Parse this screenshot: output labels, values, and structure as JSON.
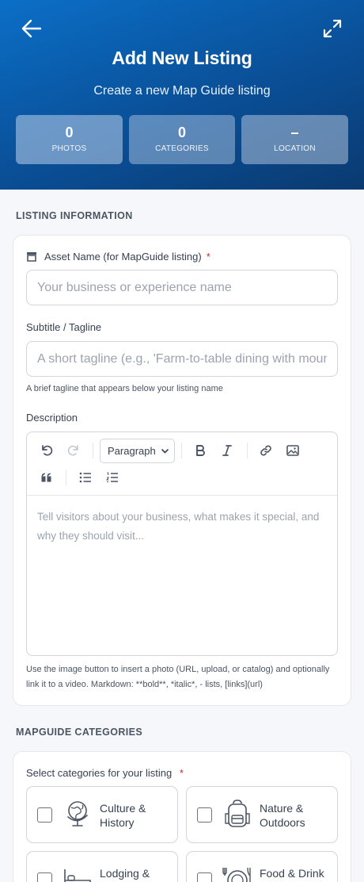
{
  "header": {
    "title": "Add New Listing",
    "subtitle": "Create a new Map Guide listing",
    "stats": [
      {
        "value": "0",
        "label": "PHOTOS"
      },
      {
        "value": "0",
        "label": "CATEGORIES"
      },
      {
        "value": "–",
        "label": "LOCATION"
      }
    ]
  },
  "listing": {
    "heading": "LISTING INFORMATION",
    "asset_label": "Asset Name (for MapGuide listing)",
    "asset_required": "*",
    "asset_placeholder": "Your business or experience name",
    "subtitle_label": "Subtitle / Tagline",
    "subtitle_placeholder": "A short tagline (e.g., 'Farm-to-table dining with mountain views')",
    "subtitle_help": "A brief tagline that appears below your listing name",
    "description_label": "Description",
    "editor": {
      "format_select": "Paragraph",
      "placeholder": "Tell visitors about your business, what makes it special, and why they should visit..."
    },
    "description_help": "Use the image button to insert a photo (URL, upload, or catalog) and optionally link it to a video. Markdown: **bold**, *italic*, - lists, [links](url)"
  },
  "categories": {
    "heading": "MAPGUIDE CATEGORIES",
    "select_label": "Select categories for your listing",
    "select_required": "*",
    "items": [
      {
        "label": "Culture & History",
        "icon": "globe-icon"
      },
      {
        "label": "Nature & Outdoors",
        "icon": "backpack-icon"
      },
      {
        "label": "Lodging & Stays",
        "icon": "bed-icon"
      },
      {
        "label": "Food & Drink",
        "icon": "dining-icon"
      }
    ]
  }
}
